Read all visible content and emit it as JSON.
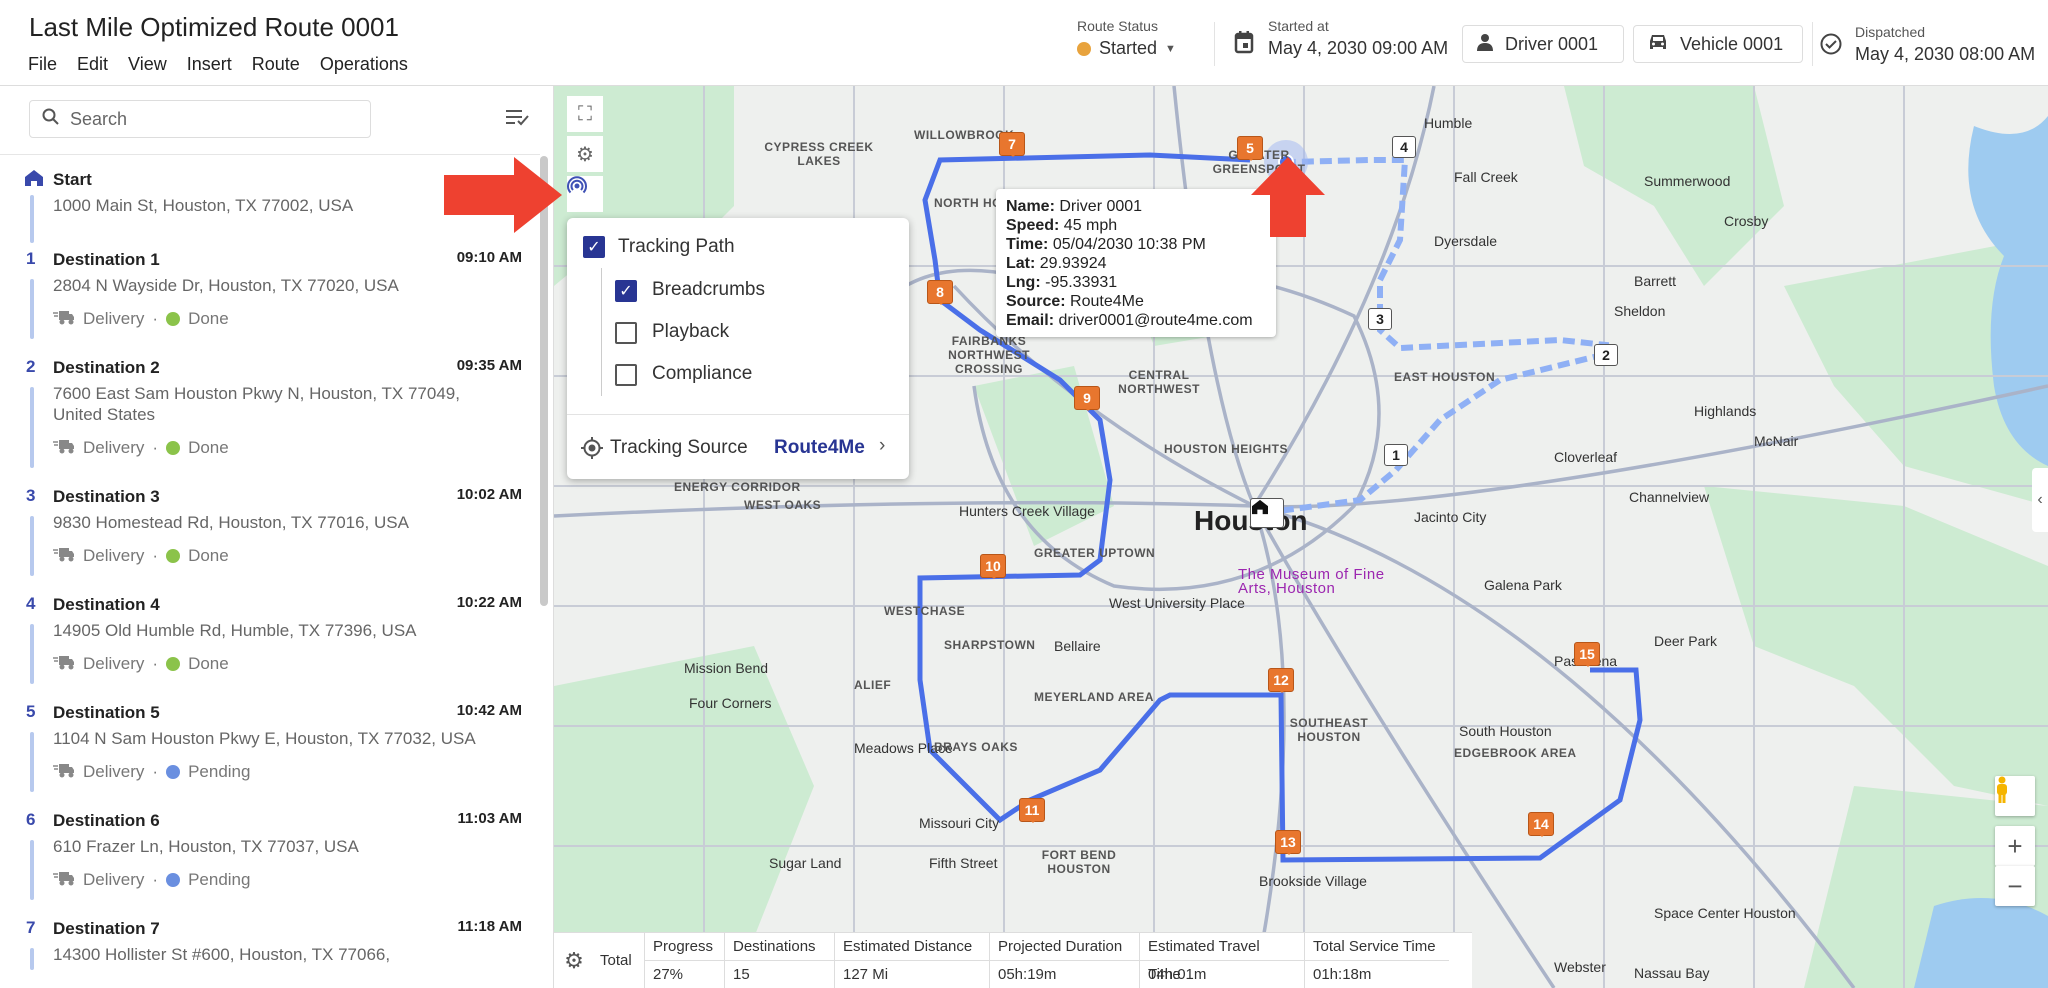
{
  "header": {
    "title": "Last Mile Optimized Route 0001",
    "menu": [
      "File",
      "Edit",
      "View",
      "Insert",
      "Route",
      "Operations"
    ],
    "route_status": {
      "label": "Route Status",
      "value": "Started",
      "color": "#e8a33d"
    },
    "started_at": {
      "label": "Started at",
      "value": "May 4, 2030 09:00 AM"
    },
    "driver": "Driver 0001",
    "vehicle": "Vehicle 0001",
    "dispatched": {
      "label": "Dispatched",
      "value": "May 4, 2030 08:00 AM"
    }
  },
  "sidebar": {
    "search_placeholder": "Search",
    "start": {
      "name": "Start",
      "address": "1000 Main St, Houston, TX 77002, USA"
    },
    "items": [
      {
        "num": "1",
        "name": "Destination 1",
        "time": "09:10 AM",
        "address": "2804 N Wayside Dr, Houston, TX 77020, USA",
        "type": "Delivery",
        "status": "Done",
        "status_color": "#8bc34a"
      },
      {
        "num": "2",
        "name": "Destination 2",
        "time": "09:35 AM",
        "address": "7600 East Sam Houston Pkwy N, Houston, TX 77049, United States",
        "type": "Delivery",
        "status": "Done",
        "status_color": "#8bc34a"
      },
      {
        "num": "3",
        "name": "Destination 3",
        "time": "10:02 AM",
        "address": "9830 Homestead Rd, Houston, TX 77016, USA",
        "type": "Delivery",
        "status": "Done",
        "status_color": "#8bc34a"
      },
      {
        "num": "4",
        "name": "Destination 4",
        "time": "10:22 AM",
        "address": "14905 Old Humble Rd, Humble, TX 77396, USA",
        "type": "Delivery",
        "status": "Done",
        "status_color": "#8bc34a"
      },
      {
        "num": "5",
        "name": "Destination 5",
        "time": "10:42 AM",
        "address": "1104 N Sam Houston Pkwy E, Houston, TX 77032, USA",
        "type": "Delivery",
        "status": "Pending",
        "status_color": "#6a8fe0"
      },
      {
        "num": "6",
        "name": "Destination 6",
        "time": "11:03 AM",
        "address": "610 Frazer Ln, Houston, TX 77037, USA",
        "type": "Delivery",
        "status": "Pending",
        "status_color": "#6a8fe0"
      },
      {
        "num": "7",
        "name": "Destination 7",
        "time": "11:18 AM",
        "address": "14300 Hollister St #600, Houston, TX 77066,",
        "type": "",
        "status": "",
        "status_color": ""
      }
    ]
  },
  "tracking_menu": {
    "tracking_path": "Tracking Path",
    "tracking_path_checked": true,
    "breadcrumbs": "Breadcrumbs",
    "breadcrumbs_checked": true,
    "playback": "Playback",
    "playback_checked": false,
    "compliance": "Compliance",
    "compliance_checked": false,
    "source_label": "Tracking Source",
    "source_value": "Route4Me"
  },
  "driver_tooltip": {
    "name_label": "Name:",
    "name": "Driver 0001",
    "speed_label": "Speed:",
    "speed": "45 mph",
    "time_label": "Time:",
    "time": "05/04/2030 10:38 PM",
    "lat_label": "Lat:",
    "lat": "29.93924",
    "lng_label": "Lng:",
    "lng": "-95.33931",
    "source_label": "Source:",
    "source": "Route4Me",
    "email_label": "Email:",
    "email": "driver0001@route4me.com"
  },
  "map": {
    "route_color": "#4a6fe8",
    "markers": [
      "7",
      "5",
      "4",
      "8",
      "3",
      "2",
      "9",
      "1",
      "10",
      "12",
      "15",
      "11",
      "13",
      "14"
    ],
    "labels": [
      "Houston",
      "Hunters Creek Village",
      "West University Place",
      "Bellaire",
      "Mission Bend",
      "Four Corners",
      "Meadows Place",
      "Missouri City",
      "Sugar Land",
      "Fifth Street",
      "Brookside Village",
      "South Houston",
      "Pasadena",
      "Deer Park",
      "Galena Park",
      "Jacinto City",
      "Channelview",
      "Cloverleaf",
      "Highlands",
      "McNair",
      "Crosby",
      "Barrett",
      "Sheldon",
      "Dyersdale",
      "Summerwood",
      "Fall Creek",
      "Humble",
      "Space Center Houston",
      "Nassau Bay",
      "Webster",
      "The Museum of Fine Arts, Houston",
      "GREATER GREENSPOINT",
      "WILLOWBROOK",
      "CYPRESS CREEK LAKES",
      "NORTH HOUSTON",
      "FAIRBANKS NORTHWEST CROSSING",
      "CENTRAL NORTHWEST",
      "HOUSTON HEIGHTS",
      "GREATER UPTOWN",
      "WESTCHASE",
      "SHARPSTOWN",
      "ALIEF",
      "MEYERLAND AREA",
      "BRAYS OAKS",
      "FORT BEND HOUSTON",
      "SOUTHEAST HOUSTON",
      "EDGEBROOK AREA",
      "EAST HOUSTON",
      "TOWNE LAKE",
      "ENERGY CORRIDOR",
      "WEST OAKS"
    ]
  },
  "totals": {
    "label": "Total",
    "columns": [
      {
        "header": "Progress",
        "value": "27%"
      },
      {
        "header": "Destinations",
        "value": "15"
      },
      {
        "header": "Estimated Distance",
        "value": "127 Mi"
      },
      {
        "header": "Projected Duration",
        "value": "05h:19m"
      },
      {
        "header": "Estimated Travel Time",
        "value": "04h:01m"
      },
      {
        "header": "Total Service Time",
        "value": "01h:18m"
      }
    ]
  }
}
